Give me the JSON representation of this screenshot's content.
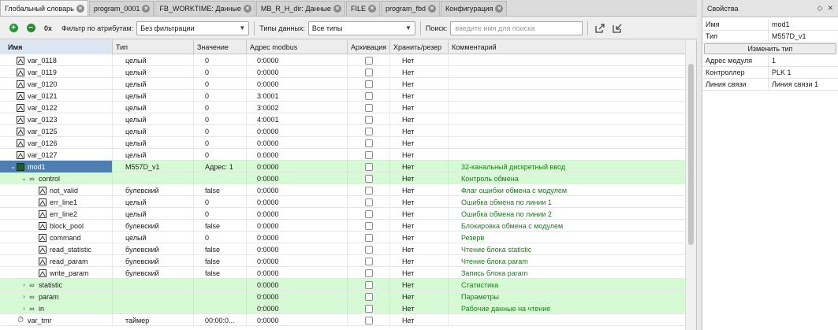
{
  "tabs": [
    {
      "label": "Глобальный словарь",
      "active": true
    },
    {
      "label": "program_0001",
      "active": false
    },
    {
      "label": "FB_WORKTIME: Данные",
      "active": false
    },
    {
      "label": "MB_R_H_dir: Данные",
      "active": false
    },
    {
      "label": "FILE",
      "active": false
    },
    {
      "label": "program_fbd",
      "active": false
    },
    {
      "label": "Конфигурация",
      "active": false
    }
  ],
  "toolbar": {
    "zero_label": "0x",
    "filter_label": "Фильтр по атрибутам:",
    "filter_value": "Без фильтрации",
    "types_label": "Типы данных:",
    "types_value": "Все типы",
    "search_label": "Поиск:",
    "search_placeholder": "введите имя для поиска"
  },
  "columns": [
    "Имя",
    "Тип",
    "Значение",
    "Адрес modbus",
    "Архивация",
    "Хранить/резер",
    "Комментарий"
  ],
  "rows": [
    {
      "name": "var_0118",
      "type": "целый",
      "value": "0",
      "addr": "0:0000",
      "keep": "Нет",
      "comment": "",
      "icon": "var-int",
      "level": 0
    },
    {
      "name": "var_0119",
      "type": "целый",
      "value": "0",
      "addr": "0:0000",
      "keep": "Нет",
      "comment": "",
      "icon": "var-int",
      "level": 0
    },
    {
      "name": "var_0120",
      "type": "целый",
      "value": "0",
      "addr": "0:0000",
      "keep": "Нет",
      "comment": "",
      "icon": "var-int",
      "level": 0
    },
    {
      "name": "var_0121",
      "type": "целый",
      "value": "0",
      "addr": "3:0001",
      "keep": "Нет",
      "comment": "",
      "icon": "var-int",
      "level": 0
    },
    {
      "name": "var_0122",
      "type": "целый",
      "value": "0",
      "addr": "3:0002",
      "keep": "Нет",
      "comment": "",
      "icon": "var-int",
      "level": 0
    },
    {
      "name": "var_0123",
      "type": "целый",
      "value": "0",
      "addr": "4:0001",
      "keep": "Нет",
      "comment": "",
      "icon": "var-int",
      "level": 0
    },
    {
      "name": "var_0125",
      "type": "целый",
      "value": "0",
      "addr": "0:0000",
      "keep": "Нет",
      "comment": "",
      "icon": "var-int",
      "level": 0
    },
    {
      "name": "var_0126",
      "type": "целый",
      "value": "0",
      "addr": "0:0000",
      "keep": "Нет",
      "comment": "",
      "icon": "var-int",
      "level": 0
    },
    {
      "name": "var_0127",
      "type": "целый",
      "value": "0",
      "addr": "0:0000",
      "keep": "Нет",
      "comment": "",
      "icon": "var-int",
      "level": 0
    },
    {
      "name": "mod1",
      "type": "M557D_v1",
      "value": "Адрес: 1",
      "addr": "0:0000",
      "keep": "Нет",
      "comment": "32-канальный дискретный ввод",
      "icon": "module",
      "level": 0,
      "green": true,
      "selected": true,
      "expander": "open"
    },
    {
      "name": "control",
      "type": "",
      "value": "",
      "addr": "0:0000",
      "keep": "Нет",
      "comment": "Контроль обмена",
      "icon": "group",
      "level": 1,
      "green": true,
      "expander": "open"
    },
    {
      "name": "not_valid",
      "type": "булевский",
      "value": "false",
      "addr": "0:0000",
      "keep": "Нет",
      "comment": "Флаг ошибки обмена с модулем",
      "icon": "var-bool",
      "level": 2
    },
    {
      "name": "err_line1",
      "type": "целый",
      "value": "0",
      "addr": "0:0000",
      "keep": "Нет",
      "comment": "Ошибка обмена по линии 1",
      "icon": "var-int",
      "level": 2
    },
    {
      "name": "err_line2",
      "type": "целый",
      "value": "0",
      "addr": "0:0000",
      "keep": "Нет",
      "comment": "Ошибка обмена по линии 2",
      "icon": "var-int",
      "level": 2
    },
    {
      "name": "block_pool",
      "type": "булевский",
      "value": "false",
      "addr": "0:0000",
      "keep": "Нет",
      "comment": "Блокировка обмена с модулем",
      "icon": "var-bool",
      "level": 2
    },
    {
      "name": "command",
      "type": "целый",
      "value": "0",
      "addr": "0:0000",
      "keep": "Нет",
      "comment": "Резерв",
      "icon": "var-int",
      "level": 2
    },
    {
      "name": "read_statistic",
      "type": "булевский",
      "value": "false",
      "addr": "0:0000",
      "keep": "Нет",
      "comment": "Чтение блока statistic",
      "icon": "var-bool",
      "level": 2
    },
    {
      "name": "read_param",
      "type": "булевский",
      "value": "false",
      "addr": "0:0000",
      "keep": "Нет",
      "comment": "Чтение блока param",
      "icon": "var-bool",
      "level": 2
    },
    {
      "name": "write_param",
      "type": "булевский",
      "value": "false",
      "addr": "0:0000",
      "keep": "Нет",
      "comment": "Запись блока param",
      "icon": "var-bool",
      "level": 2
    },
    {
      "name": "statistic",
      "type": "",
      "value": "",
      "addr": "0:0000",
      "keep": "Нет",
      "comment": "Статистика",
      "icon": "group",
      "level": 1,
      "green": true,
      "expander": "closed"
    },
    {
      "name": "param",
      "type": "",
      "value": "",
      "addr": "0:0000",
      "keep": "Нет",
      "comment": "Параметры",
      "icon": "group",
      "level": 1,
      "green": true,
      "expander": "closed"
    },
    {
      "name": "in",
      "type": "",
      "value": "",
      "addr": "0:0000",
      "keep": "Нет",
      "comment": "Рабочие данные на чтение",
      "icon": "group",
      "level": 1,
      "green": true,
      "expander": "closed"
    },
    {
      "name": "var_tmr",
      "type": "таймер",
      "value": "00:00:0...",
      "addr": "0:0000",
      "keep": "Нет",
      "comment": "",
      "icon": "timer",
      "level": 0
    }
  ],
  "properties": {
    "title": "Свойства",
    "rows_top": [
      {
        "key": "Имя",
        "value": "mod1"
      },
      {
        "key": "Тип",
        "value": "M557D_v1"
      }
    ],
    "change_type_label": "Изменить тип",
    "rows_bottom": [
      {
        "key": "Адрес модуля",
        "value": "1"
      },
      {
        "key": "Контроллер",
        "value": "PLK 1"
      },
      {
        "key": "Линия связи",
        "value": "Линия связи 1"
      }
    ]
  },
  "colors": {
    "row_highlight": "#d6fbd4",
    "comment_text": "#1e7a1e",
    "selection": "#4f7fb0",
    "header_first": "#dbe6f3"
  }
}
